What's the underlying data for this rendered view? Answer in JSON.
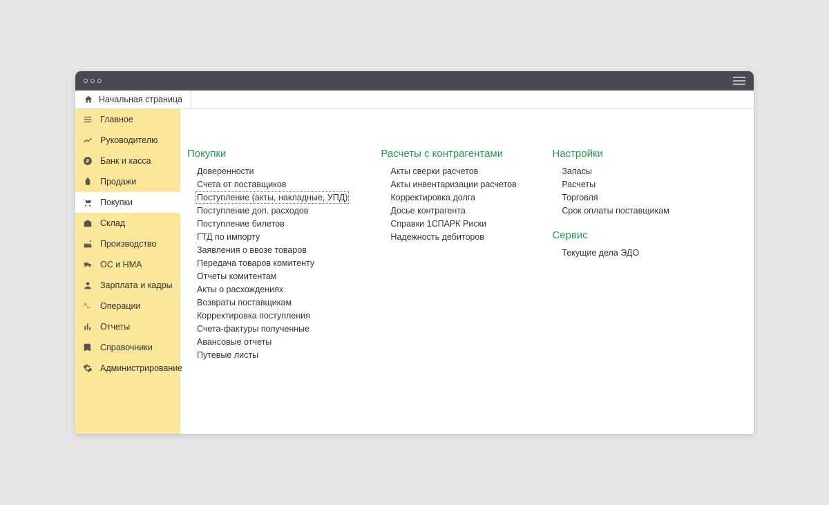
{
  "tab": {
    "label": "Начальная страница"
  },
  "sidebar": {
    "items": [
      {
        "label": "Главное"
      },
      {
        "label": "Руководителю"
      },
      {
        "label": "Банк и касса"
      },
      {
        "label": "Продажи"
      },
      {
        "label": "Покупки"
      },
      {
        "label": "Склад"
      },
      {
        "label": "Производство"
      },
      {
        "label": "ОС и НМА"
      },
      {
        "label": "Зарплата и кадры"
      },
      {
        "label": "Операции"
      },
      {
        "label": "Отчеты"
      },
      {
        "label": "Справочники"
      },
      {
        "label": "Администрирование"
      }
    ]
  },
  "sections": {
    "purchases": {
      "title": "Покупки",
      "items": [
        "Доверенности",
        "Счета от поставщиков",
        "Поступление (акты, накладные, УПД)",
        "Поступление доп. расходов",
        "Поступление билетов",
        "ГТД по импорту",
        "Заявления о ввозе товаров",
        "Передача товаров комитенту",
        "Отчеты комитентам",
        "Акты о расхождениях",
        "Возвраты поставщикам",
        "Корректировка поступления",
        "Счета-фактуры полученные",
        "Авансовые отчеты",
        "Путевые листы"
      ]
    },
    "settlements": {
      "title": "Расчеты с контрагентами",
      "items": [
        "Акты сверки расчетов",
        "Акты инвентаризации расчетов",
        "Корректировка долга",
        "Досье контрагента",
        "Справки 1СПАРК Риски",
        "Надежность дебиторов"
      ]
    },
    "settings": {
      "title": "Настройки",
      "items": [
        "Запасы",
        "Расчеты",
        "Торговля",
        "Срок оплаты поставщикам"
      ]
    },
    "service": {
      "title": "Сервис",
      "items": [
        "Текущие дела ЭДО"
      ]
    }
  }
}
